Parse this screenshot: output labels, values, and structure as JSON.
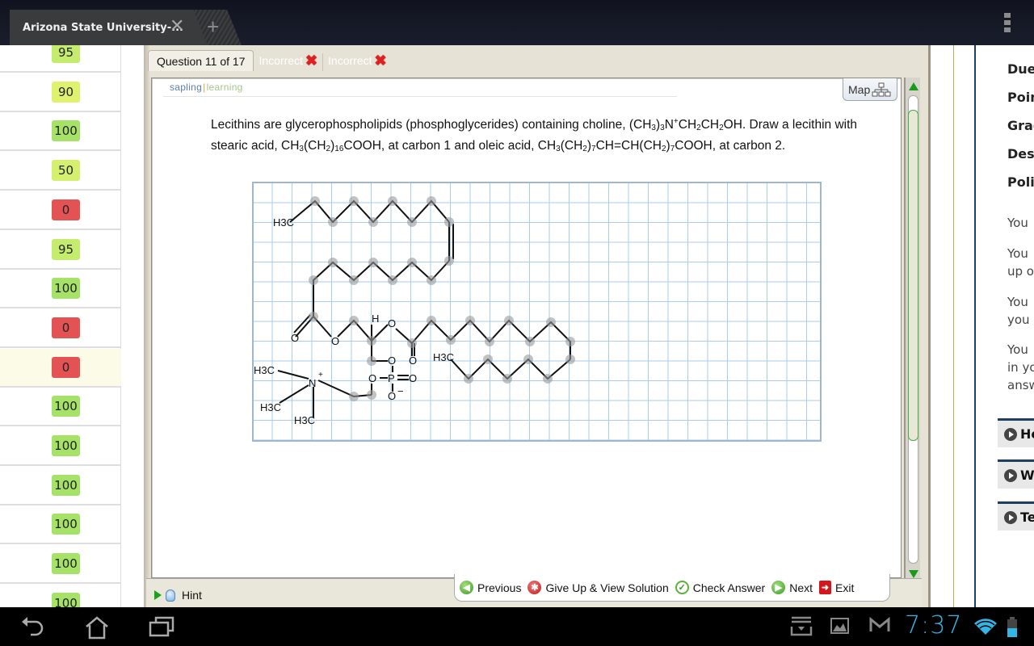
{
  "browser": {
    "tab_title": "Arizona State University-...",
    "close_icon": "close-icon",
    "new_tab_icon": "plus-icon",
    "menu_icon": "overflow-menu-icon"
  },
  "scores": [
    {
      "value": "95",
      "color": "#c6ec6e"
    },
    {
      "value": "90",
      "color": "#dff26e"
    },
    {
      "value": "100",
      "color": "#a5e267"
    },
    {
      "value": "50",
      "color": "#d4f06e"
    },
    {
      "value": "0",
      "color": "#e45353"
    },
    {
      "value": "95",
      "color": "#c6ec6e"
    },
    {
      "value": "100",
      "color": "#a5e267"
    },
    {
      "value": "0",
      "color": "#e45353"
    },
    {
      "value": "0",
      "color": "#e45353",
      "highlight": true
    },
    {
      "value": "100",
      "color": "#a5e267"
    },
    {
      "value": "100",
      "color": "#a5e267"
    },
    {
      "value": "100",
      "color": "#a5e267"
    },
    {
      "value": "100",
      "color": "#a5e267"
    },
    {
      "value": "100",
      "color": "#a5e267"
    },
    {
      "value": "100",
      "color": "#a5e267"
    }
  ],
  "question_header": {
    "tab_label": "Question 11 of 17",
    "attempts": [
      "Incorrect",
      "Incorrect"
    ],
    "attempt_icon": "red-x-icon"
  },
  "brand": {
    "part1": "sapling",
    "part2": "learning"
  },
  "map_button": {
    "label": "Map",
    "icon": "sitemap-icon"
  },
  "question": {
    "line1_a": "Lecithins are glycerophospholipids (phosphoglycerides) containing choline, (CH",
    "line1_sub1": "3",
    "line1_b": ")",
    "line1_sub2": "3",
    "line1_c": "N",
    "line1_sup": "+",
    "line1_d": "CH",
    "line1_sub3": "2",
    "line1_e": "CH",
    "line1_sub4": "2",
    "line1_f": "OH. Draw a lecithin with stearic acid, CH",
    "s_sub1": "3",
    "s_b": "(CH",
    "s_sub2": "2",
    "s_c": ")",
    "s_sub3": "16",
    "s_d": "COOH, at carbon 1 and oleic acid, CH",
    "o_sub1": "3",
    "o_b": "(CH",
    "o_sub2": "2",
    "o_c": ")",
    "o_sub3": "7",
    "o_d": "CH=CH(CH",
    "o_sub4": "2",
    "o_e": ")",
    "o_sub5": "7",
    "o_f": "COOH, at carbon 2."
  },
  "drawing": {
    "labels": {
      "h3c_top": "H3C",
      "h_label": "H",
      "o_ester1": "O",
      "o_carbonyl1": "O",
      "o_ester2": "O",
      "o_carbonyl2": "O",
      "o_glycerol": "O",
      "o_phosphate_link": "O",
      "p": "P",
      "o_double": "O",
      "o_minus": "O",
      "minus": "−",
      "n": "N",
      "plus": "+",
      "h3c_n1": "H3C",
      "h3c_n2": "H3C",
      "h3c_n3": "H3C",
      "h3c_right": "H3C"
    }
  },
  "bottom_bar": {
    "hint": "Hint",
    "previous": "Previous",
    "give_up": "Give Up & View Solution",
    "check": "Check Answer",
    "next": "Next",
    "exit": "Exit"
  },
  "right_panel": {
    "labels": [
      "Due",
      "Poin",
      "Grad",
      "Desc",
      "Polic"
    ],
    "texts": [
      "You",
      "You\nup o",
      "You\nyou",
      "You\nin yo\nansw"
    ],
    "buttons": [
      "He",
      "W",
      "Te"
    ]
  },
  "system": {
    "clock": "7:37",
    "icons": [
      "back-icon",
      "home-icon",
      "recent-apps-icon",
      "download-icon",
      "gallery-icon",
      "gmail-icon",
      "wifi-icon",
      "battery-icon"
    ]
  }
}
